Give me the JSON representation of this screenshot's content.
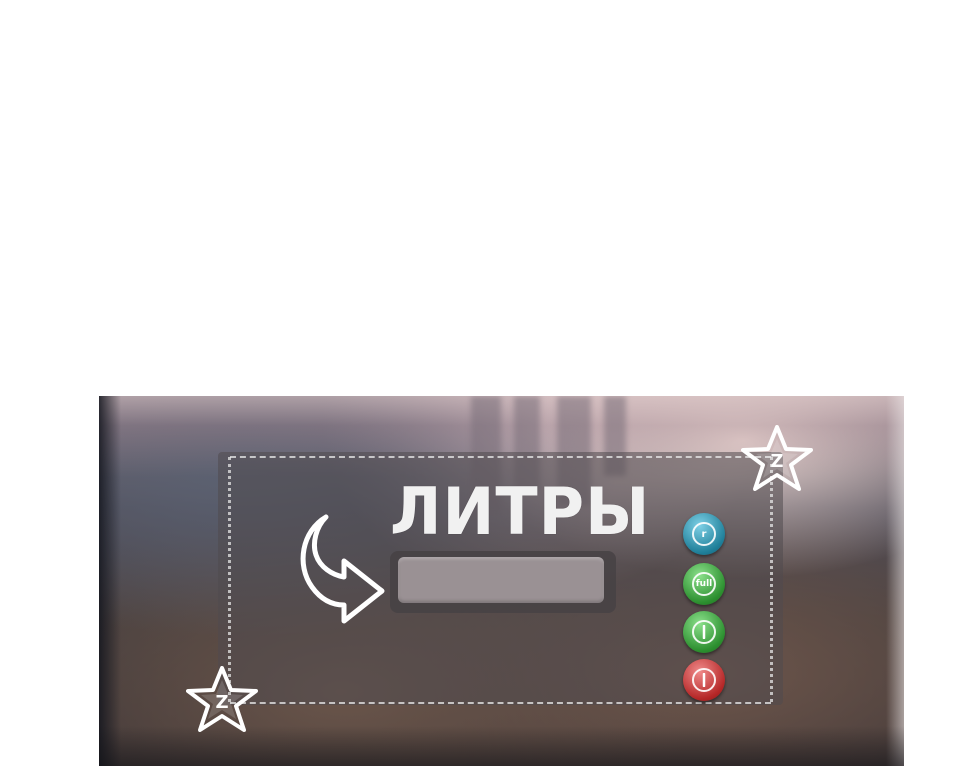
{
  "panel": {
    "title": "ЛИТРЫ",
    "input": {
      "value": "",
      "placeholder": ""
    }
  },
  "buttons": [
    {
      "name": "reset",
      "label": "r",
      "color": "#1f7f99"
    },
    {
      "name": "full",
      "label": "full",
      "color": "#2c8f2f"
    },
    {
      "name": "power-on",
      "label": "",
      "color": "#2c8f2f"
    },
    {
      "name": "power-off",
      "label": "",
      "color": "#b52727"
    }
  ],
  "badges": {
    "top_label": "Z",
    "bottom_label": "Z"
  },
  "icons": {
    "arrow": "curved-arrow-right-icon",
    "badge": "star-z-badge-icon",
    "power": "power-icon"
  },
  "colors": {
    "card_bg": "rgba(80,75,78,0.55)",
    "text": "#f1f1f1",
    "input_bg": "#9a9194"
  }
}
